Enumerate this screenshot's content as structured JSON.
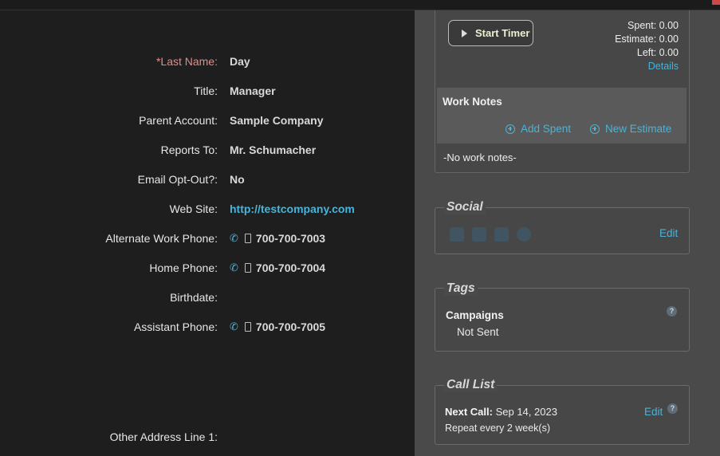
{
  "fields": [
    {
      "label": "*Last Name:",
      "value": "Day"
    },
    {
      "label": "Title:",
      "value": "Manager"
    },
    {
      "label": "Parent Account:",
      "value": "Sample Company"
    },
    {
      "label": "Reports To:",
      "value": "Mr. Schumacher"
    },
    {
      "label": "Email Opt-Out?:",
      "value": "No"
    },
    {
      "label": "Web Site:",
      "value": "http://testcompany.com"
    },
    {
      "label": "Alternate Work Phone:",
      "value": "700-700-7003"
    },
    {
      "label": "Home Phone:",
      "value": "700-700-7004"
    },
    {
      "label": "Birthdate:",
      "value": ""
    },
    {
      "label": "Assistant Phone:",
      "value": "700-700-7005"
    },
    {
      "label": "Other Address Line 1:",
      "value": ""
    }
  ],
  "timer": {
    "start_label": "Start Timer",
    "spent": "Spent: 0.00",
    "estimate": "Estimate: 0.00",
    "left": "Left: 0.00",
    "details": "Details"
  },
  "work_notes": {
    "title": "Work Notes",
    "add_spent": "Add Spent",
    "new_estimate": "New Estimate",
    "empty": "-No work notes-"
  },
  "social": {
    "legend": "Social",
    "edit": "Edit",
    "icons": [
      "facebook-icon",
      "twitter-icon",
      "linkedin-icon",
      "skype-icon"
    ]
  },
  "tags": {
    "legend": "Tags",
    "title": "Campaigns",
    "value": "Not Sent",
    "help": "?"
  },
  "call_list": {
    "legend": "Call List",
    "next_call_label": "Next Call:",
    "next_call_value": " Sep 14, 2023",
    "repeat": "Repeat every 2 week(s)",
    "edit": "Edit",
    "help": "?"
  },
  "colors": {
    "accent": "#4ab3d8",
    "required": "#e58a8a"
  }
}
